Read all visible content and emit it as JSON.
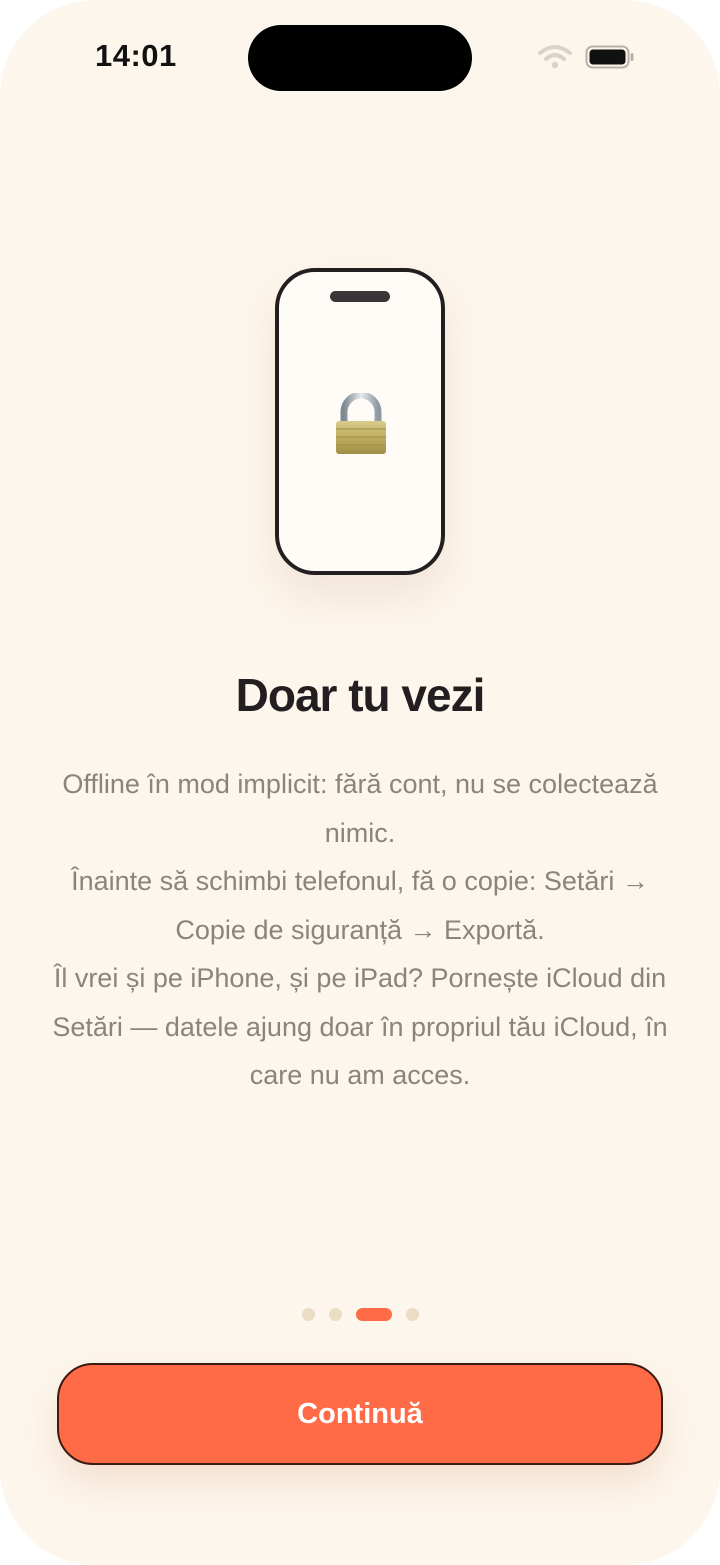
{
  "status_bar": {
    "time": "14:01",
    "icons": [
      "wifi-icon",
      "battery-icon"
    ]
  },
  "illustration": {
    "icon": "lock-icon"
  },
  "onboarding": {
    "title": "Doar tu vezi",
    "paragraphs": [
      "Offline în mod implicit: fără cont, nu se colectează nimic.",
      "Înainte să schimbi telefonul, fă o copie: Setări → Copie de siguranță → Exportă.",
      "Îl vrei și pe iPhone, și pe iPad? Pornește iCloud din Setări — datele ajung doar în propriul tău iCloud, în care nu am acces."
    ]
  },
  "pager": {
    "page_count": 4,
    "current_page": 3
  },
  "actions": {
    "continue_label": "Continuă"
  },
  "colors": {
    "background": "#fdf6ec",
    "accent": "#ff6a47",
    "title": "#231f20",
    "body_text": "#8a857c",
    "dot_inactive": "#ebdcc5"
  }
}
